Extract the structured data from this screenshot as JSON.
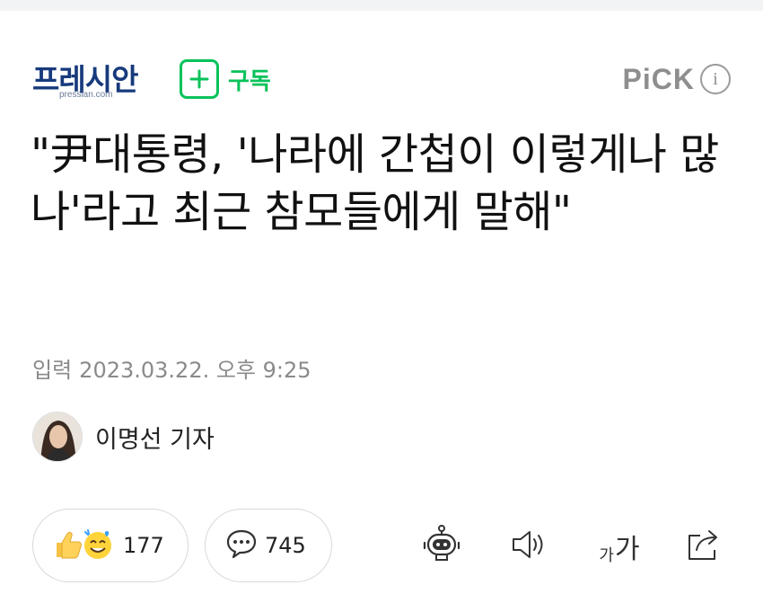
{
  "header": {
    "logo_text": "프레시안",
    "logo_sub": "pressian.com",
    "subscribe_label": "구독",
    "pick_label": "PiCK",
    "info_glyph": "i"
  },
  "article": {
    "title": "\"尹대통령, '나라에 간첩이 이렇게나 많나'라고 최근 참모들에게 말해\"",
    "date_label": "입력",
    "date_value": "2023.03.22. 오후 9:25",
    "reporter": "이명선 기자"
  },
  "actions": {
    "reaction_count": "177",
    "comment_count": "745",
    "font_small": "가",
    "font_big": "가"
  },
  "icons": [
    "plus-icon",
    "info-icon",
    "thumbs-up-emoji-icon",
    "smile-emoji-icon",
    "comment-bubble-icon",
    "robot-icon",
    "speaker-icon",
    "font-size-icon",
    "share-icon"
  ],
  "colors": {
    "brand": "#173a7c",
    "subscribe_green": "#08c25a",
    "muted": "#8a8a8a"
  }
}
